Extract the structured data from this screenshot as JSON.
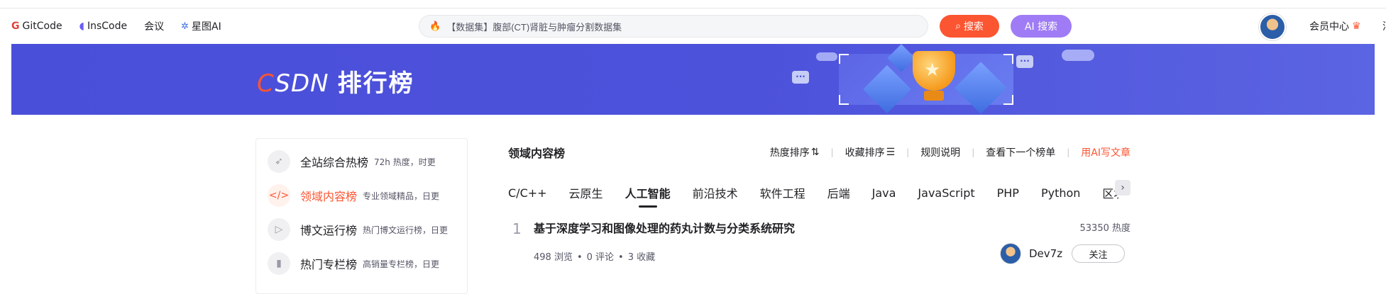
{
  "header": {
    "nav": [
      {
        "label": "GitCode",
        "icon": "gitcode-icon"
      },
      {
        "label": "InsCode",
        "icon": "inscode-icon"
      },
      {
        "label": "会议"
      },
      {
        "label": "星图AI",
        "icon": "xingtu-icon"
      }
    ],
    "search": {
      "value": "【数据集】腹部(CT)肾脏与肿瘤分割数据集",
      "icon": "fire-icon"
    },
    "search_button": "搜索",
    "ai_search_button": "AI 搜索",
    "member_center": "会员中心",
    "edge_text": "消"
  },
  "banner": {
    "logo_text": "CSDN",
    "title": "排行榜"
  },
  "sidebar": {
    "items": [
      {
        "label": "全站综合热榜",
        "sub": "72h 热度，时更",
        "icon": "rocket-icon",
        "active": false
      },
      {
        "label": "领域内容榜",
        "sub": "专业领域精品，日更",
        "icon": "code-icon",
        "active": true
      },
      {
        "label": "博文运行榜",
        "sub": "热门博文运行榜，日更",
        "icon": "play-icon",
        "active": false
      },
      {
        "label": "热门专栏榜",
        "sub": "高销量专栏榜，日更",
        "icon": "book-icon",
        "active": false
      }
    ]
  },
  "main": {
    "title": "领域内容榜",
    "actions": [
      "热度排序",
      "收藏排序",
      "规则说明",
      "查看下一个榜单",
      "用AI写文章"
    ],
    "tabs": [
      "C/C++",
      "云原生",
      "人工智能",
      "前沿技术",
      "软件工程",
      "后端",
      "Java",
      "JavaScript",
      "PHP",
      "Python",
      "区块链"
    ],
    "active_tab": "人工智能",
    "rows": [
      {
        "rank": "1",
        "title": "基于深度学习和图像处理的药丸计数与分类系统研究",
        "heat": "53350 热度",
        "views": "498 浏览",
        "comments": "0 评论",
        "favorites": "3 收藏",
        "author": "Dev7z",
        "follow_label": "关注"
      }
    ]
  },
  "colors": {
    "accent": "#fc5531",
    "banner": "#4a4fd9",
    "ai": "#9f7cf5"
  }
}
